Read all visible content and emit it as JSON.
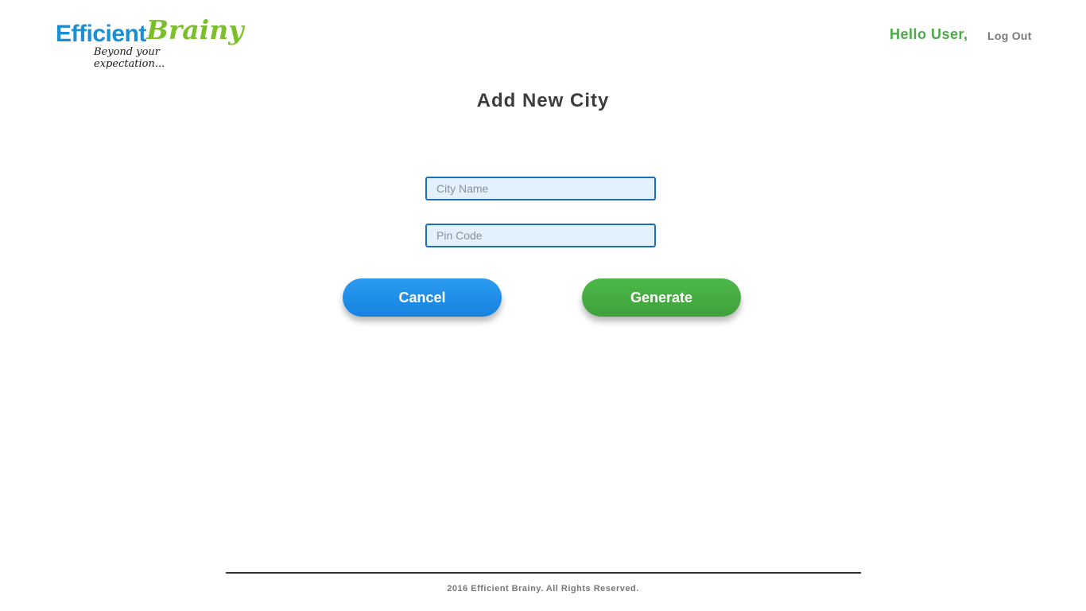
{
  "header": {
    "logo": {
      "word1": "Efficient",
      "word2": "Brainy",
      "tagline": "Beyond your expectation..."
    },
    "greeting": "Hello User,",
    "logout_label": "Log Out"
  },
  "main": {
    "title": "Add New City",
    "city_field": {
      "placeholder": "City Name",
      "value": ""
    },
    "pin_field": {
      "placeholder": "Pin Code",
      "value": ""
    },
    "cancel_label": "Cancel",
    "generate_label": "Generate"
  },
  "footer": {
    "copyright": "2016 Efficient Brainy. All Rights Reserved."
  },
  "colors": {
    "brand_blue": "#1a8fd4",
    "brand_green": "#7bbf2a",
    "greeting_green": "#4aaa47",
    "cancel_blue": "#1e8ee8",
    "generate_green": "#45ad41",
    "input_border": "#1e6fb9",
    "input_bg": "#e3f1fc"
  }
}
